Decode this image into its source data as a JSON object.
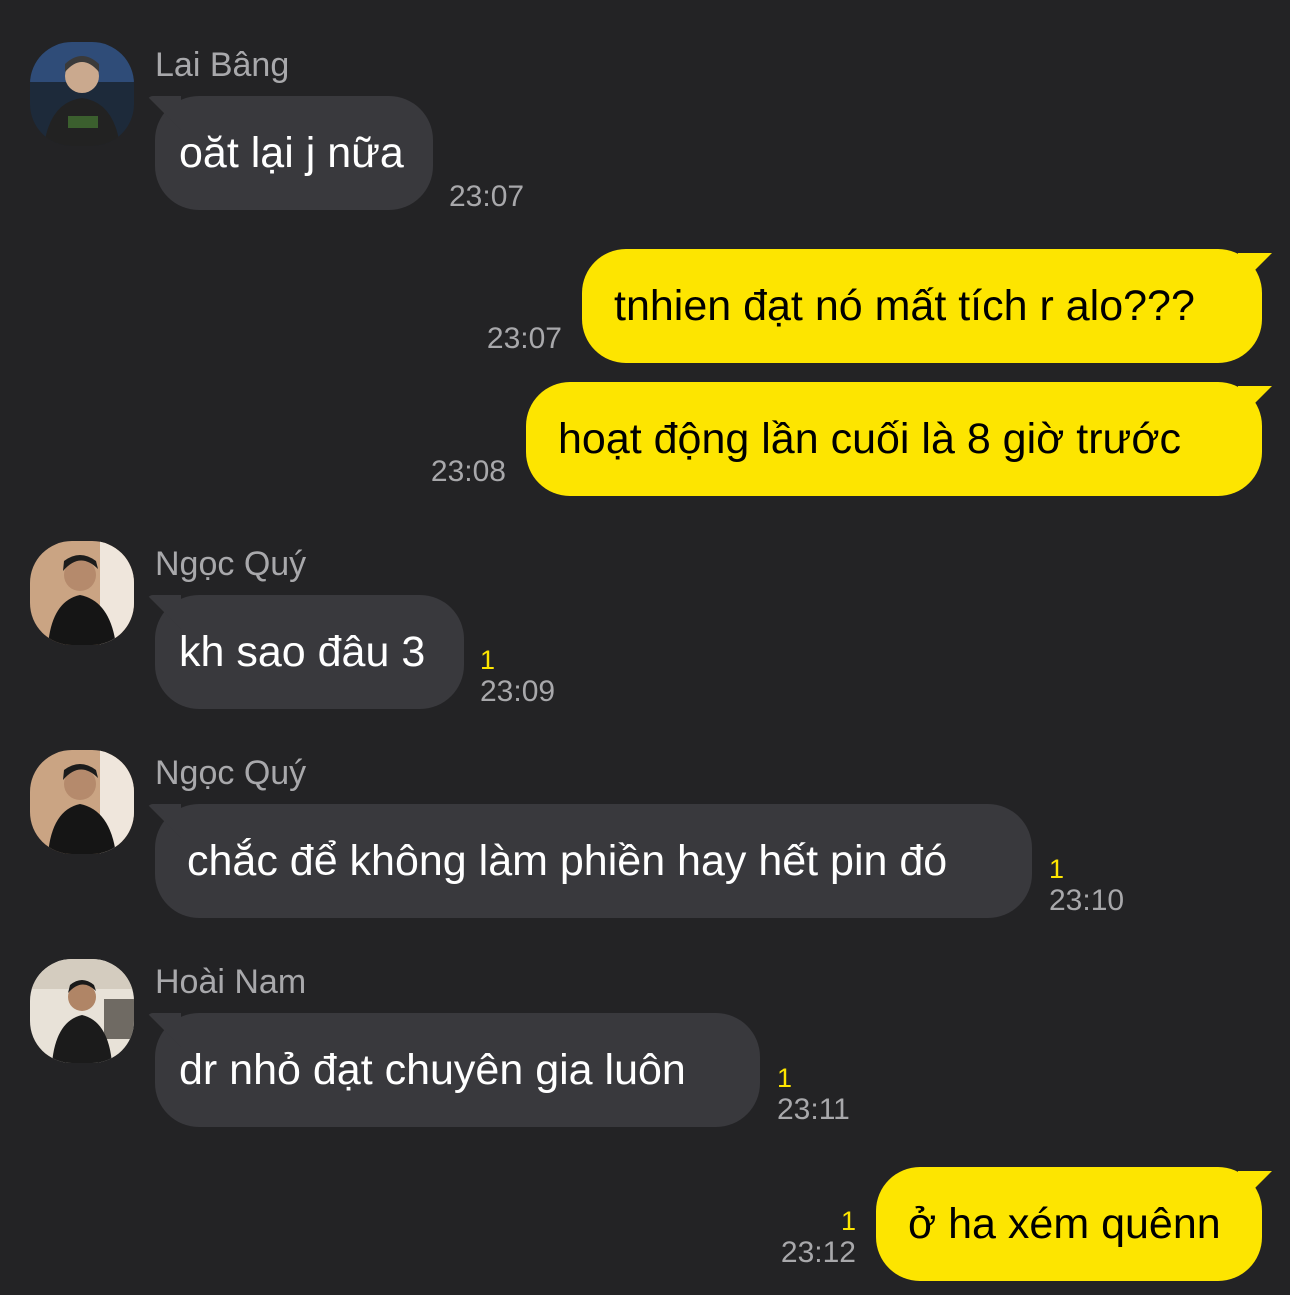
{
  "messages": [
    {
      "type": "in",
      "sender": "Lai Bâng",
      "avatar": "avatar-lai-bang",
      "text": "oăt lại j nữa",
      "time": "23:07"
    },
    {
      "type": "out",
      "text": "tnhien đạt nó mất tích r alo???",
      "time": "23:07"
    },
    {
      "type": "out",
      "text": "hoạt động lần cuối là 8 giờ trước",
      "time": "23:08"
    },
    {
      "type": "in",
      "sender": "Ngọc Quý",
      "avatar": "avatar-ngoc-quy",
      "text": "kh sao đâu 3",
      "unread": "1",
      "time": "23:09"
    },
    {
      "type": "in",
      "sender": "Ngọc Quý",
      "avatar": "avatar-ngoc-quy",
      "text": "chắc để không làm phiền hay hết pin đó",
      "unread": "1",
      "time": "23:10"
    },
    {
      "type": "in",
      "sender": "Hoài Nam",
      "avatar": "avatar-hoai-nam",
      "text": "dr nhỏ đạt chuyên gia luôn",
      "unread": "1",
      "time": "23:11"
    },
    {
      "type": "out",
      "text": "ở ha xém quênn",
      "unread": "1",
      "time": "23:12"
    }
  ],
  "colors": {
    "background": "#232325",
    "incoming_bubble": "#39393d",
    "outgoing_bubble": "#fde500",
    "muted_text": "#a8a8ab",
    "unread_count": "#fde500"
  }
}
